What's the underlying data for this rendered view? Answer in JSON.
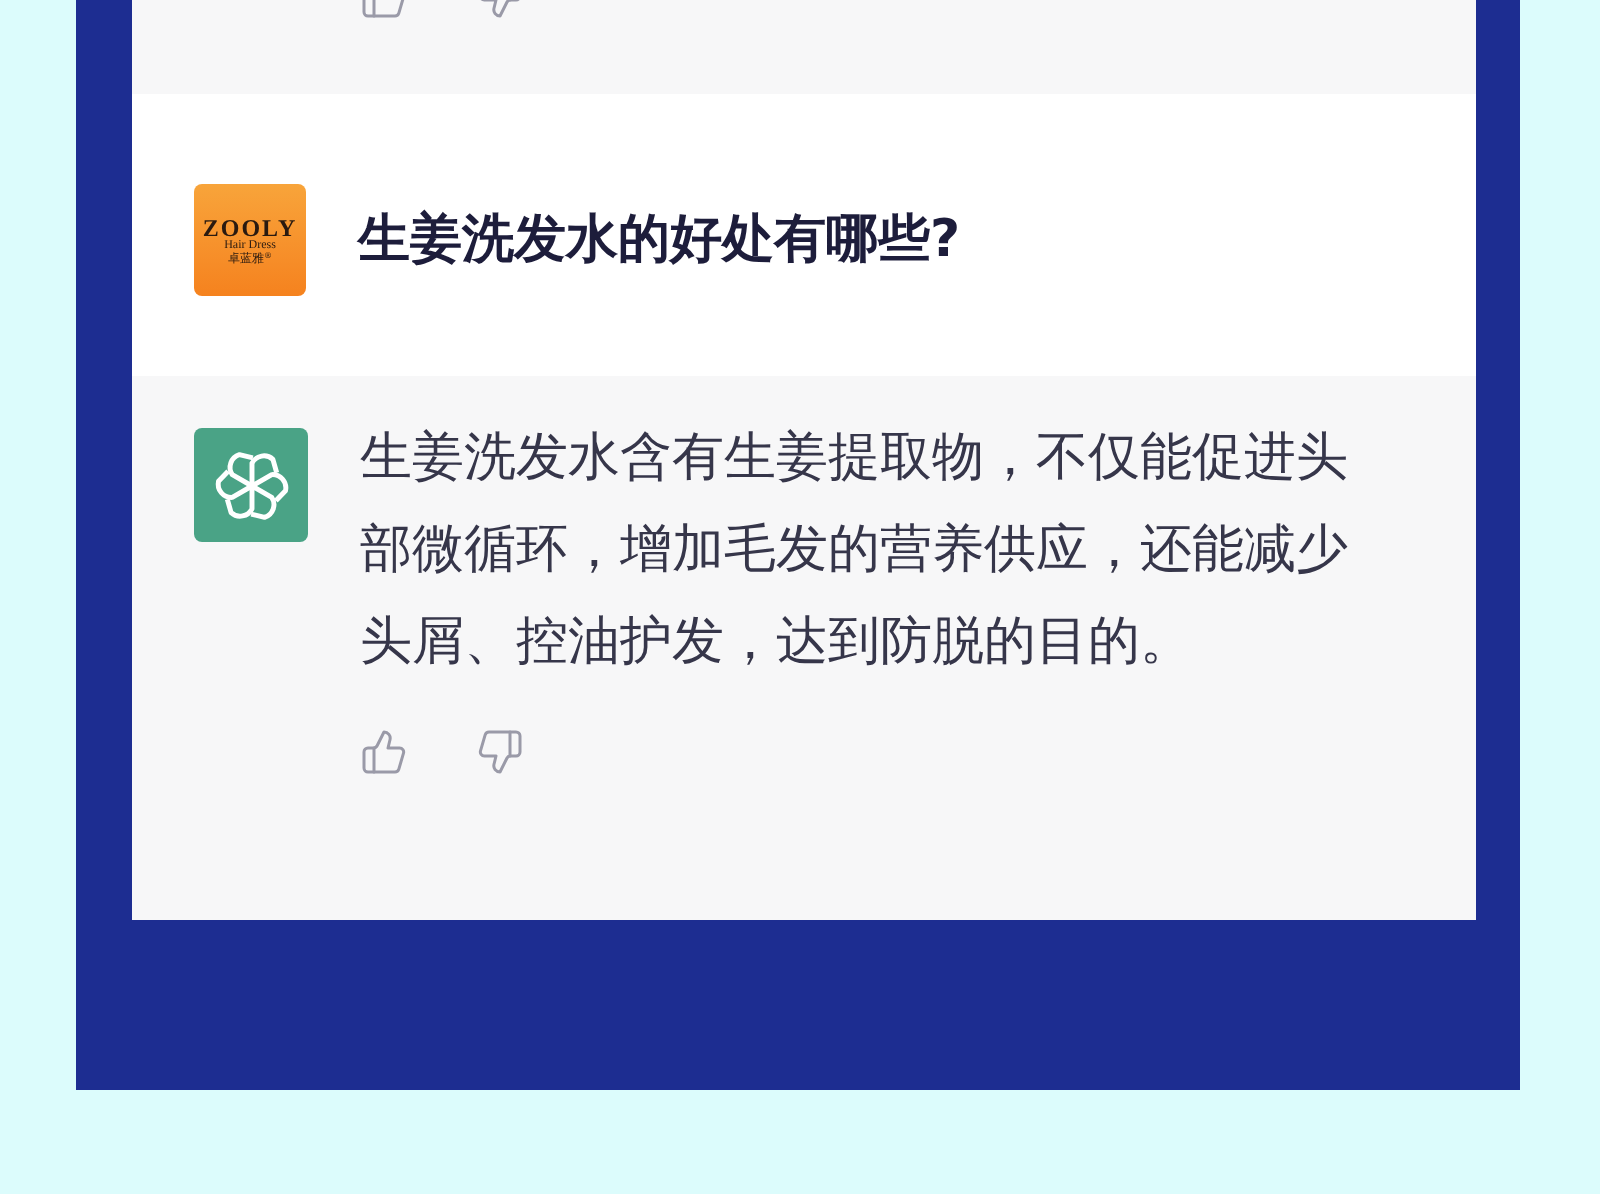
{
  "messages": [
    {
      "kind": "partial_answer"
    },
    {
      "kind": "question",
      "logo": {
        "brand": "ZOOLY",
        "tagline": "Hair Dress",
        "chinese": "卓蓝雅",
        "mark": "®"
      },
      "text": "生姜洗发水的好处有哪些?"
    },
    {
      "kind": "answer",
      "text": "生姜洗发水含有生姜提取物，不仅能促进头部微循环，增加毛发的营养供应，还能减少头屑、控油护发，达到防脱的目的。"
    }
  ]
}
